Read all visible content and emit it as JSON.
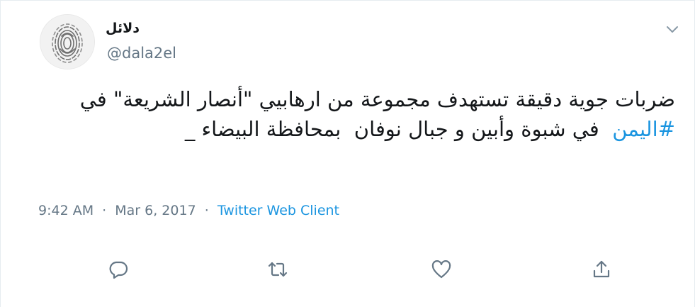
{
  "tweet": {
    "display_name": "دلائل",
    "handle": "@dala2el",
    "text_before_hashtag": "ضربات جوية دقيقة تستهدف مجموعة من ارهابيي \"أنصار الشريعة\" في ",
    "hashtag": "#اليمن",
    "text_after_hashtag": "  في شبوة وأبين و جبال نوفان  بمحافظة البيضاء _",
    "time": "9:42 AM",
    "separator": "·",
    "date": "Mar 6, 2017",
    "source": "Twitter Web Client"
  },
  "icons": {
    "caret": "chevron-down-icon",
    "reply": "reply-icon",
    "retweet": "retweet-icon",
    "like": "heart-icon",
    "share": "share-icon"
  },
  "colors": {
    "link": "#1b95e0",
    "secondary": "#657786",
    "icon": "#657786",
    "text": "#14171a"
  }
}
